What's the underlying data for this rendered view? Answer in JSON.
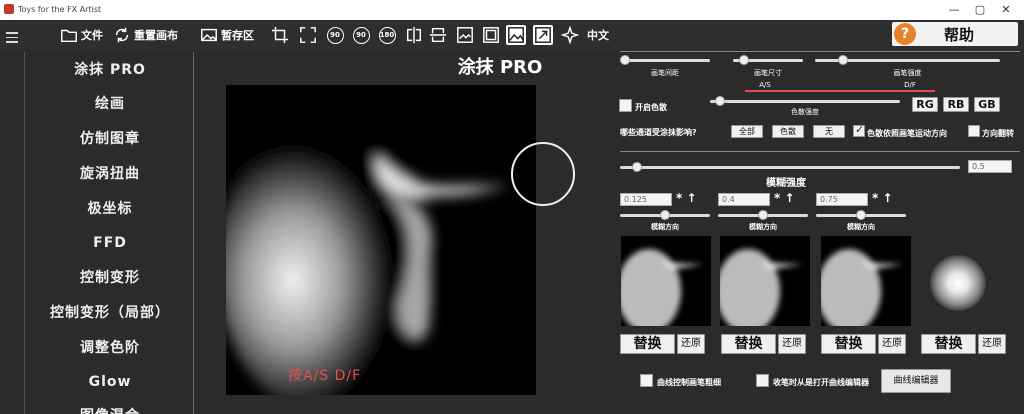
{
  "window": {
    "title": "Toys for the FX Artist",
    "minimize": "—",
    "restore": "▢",
    "close": "✕"
  },
  "toolbar": {
    "file": "文件",
    "reset_canvas": "重置画布",
    "scratch": "暂存区",
    "lang": "中文",
    "rot90_a": "90",
    "rot90_b": "90",
    "rot180": "180"
  },
  "help": {
    "label": "帮助",
    "icon": "?"
  },
  "sidebar": {
    "items": [
      "涂抹 PRO",
      "绘画",
      "仿制图章",
      "旋涡扭曲",
      "极坐标",
      "FFD",
      "控制变形",
      "控制变形（局部）",
      "调整色阶",
      "Glow",
      "图像混合"
    ]
  },
  "canvas": {
    "title": "涂抹 PRO",
    "hint": "按A/S   D/F"
  },
  "controls": {
    "brush_spacing": "画笔间距",
    "brush_size": "画笔尺寸",
    "brush_strength": "画笔强度",
    "hotkey_as": "A/S",
    "hotkey_df": "D/F",
    "enable_dispersion": "开启色散",
    "dispersion_strength": "色散强度",
    "rg": "RG",
    "rb": "RB",
    "gb": "GB",
    "channels_question": "哪些通道受涂抹影响?",
    "all": "全部",
    "dispersion": "色散",
    "none": "无",
    "disp_follow": "色散依照画笔运动方向",
    "dir_flip": "方向翻转",
    "blur_strength_label": "模糊强度",
    "blur_strength_value": "0.5",
    "blur_inputs": [
      "0.125",
      "0.4",
      "0.75"
    ],
    "blur_dir": "模糊方向",
    "replace": "替换",
    "restore": "还原",
    "curve_control": "曲线控制画笔粗细",
    "curve_open": "收笔时从是打开曲线编辑器",
    "curve_editor": "曲线编辑器"
  },
  "values": {
    "brush_spacing": 0.05,
    "brush_size": 0.15,
    "brush_strength": 0.15,
    "dispersion_strength": 0.05,
    "blur_strength": 0.05,
    "blur_dir": [
      0.5,
      0.5,
      0.5
    ]
  },
  "colors": {
    "accent_red": "#e05050",
    "help_orange": "#e8822a",
    "background": "#2b2b2b"
  }
}
